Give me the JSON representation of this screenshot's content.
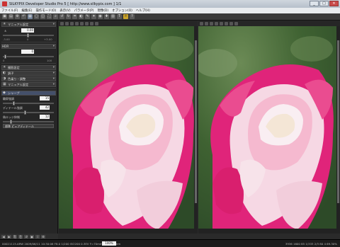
{
  "window": {
    "title": "SILKYPIX Developer Studio Pro 5 [ http://www.silkypix.com ]   1/1",
    "minimize": "_",
    "maximize": "□",
    "close": "✕"
  },
  "menu": [
    "ファイル(F)",
    "編集(E)",
    "操作モード(O)",
    "表示(V)",
    "パラメータ(P)",
    "現像(D)",
    "オプション(O)",
    "ヘルプ(H)"
  ],
  "toolbar_icons": [
    "open-icon",
    "save-icon",
    "develop-icon",
    "undo-icon",
    "grid-icon",
    "single-view-icon",
    "compare-view-icon",
    "full-view-icon",
    "zoom-icon",
    "rotate-left-icon",
    "rotate-right-icon",
    "crop-icon",
    "white-balance-icon",
    "eyedropper-icon",
    "dust-icon",
    "spot-icon",
    "gray-point-icon",
    "level-icon",
    "text-icon",
    "highlight-icon",
    "help-icon"
  ],
  "toolbar_glyphs": [
    "▣",
    "▤",
    "⚙",
    "↶",
    "▦",
    "▢",
    "◫",
    "⛶",
    "⌕",
    "↺",
    "↻",
    "⌗",
    "◐",
    "✎",
    "✦",
    "◉",
    "✚",
    "▥",
    "T",
    "☼",
    "?"
  ],
  "panel": {
    "manual_label": "マニュアル設定",
    "exposure_value": "0.00",
    "exposure_min": "-3.00",
    "exposure_mid": "0",
    "exposure_max": "+3.00",
    "hdr_label": "HDR",
    "hdr_value": "0",
    "hdr_min": "0",
    "hdr_max": "100",
    "sections": [
      {
        "label": "撮影設定",
        "icon": "☀"
      },
      {
        "label": "調子",
        "icon": "◐"
      },
      {
        "label": "色乗り・調整",
        "icon": "◑"
      },
      {
        "label": "マニュアル設定",
        "icon": "▦"
      }
    ],
    "sharp_label": "シャープ",
    "params": [
      {
        "label": "輪郭強調",
        "value": "15"
      },
      {
        "label": "ディテール強調",
        "value": "42"
      },
      {
        "label": "偽エッジ抑制",
        "value": "12"
      }
    ],
    "preset": "標準 ピュアディテール"
  },
  "view_icons": [
    "fit-icon",
    "100-icon",
    "compare-icon",
    "rotate-icon",
    "flip-icon",
    "undo-icon",
    "redo-icon",
    "info-icon"
  ],
  "status": {
    "left": "00021115.ARW  2009/06/11 10:30:06 F8.0 1/200 ISO200 0.3EV F=70mm F=105 3mm",
    "zoom": "100%",
    "right": "3936  1600  85  1/333  2/3  80  4  69.30%"
  }
}
